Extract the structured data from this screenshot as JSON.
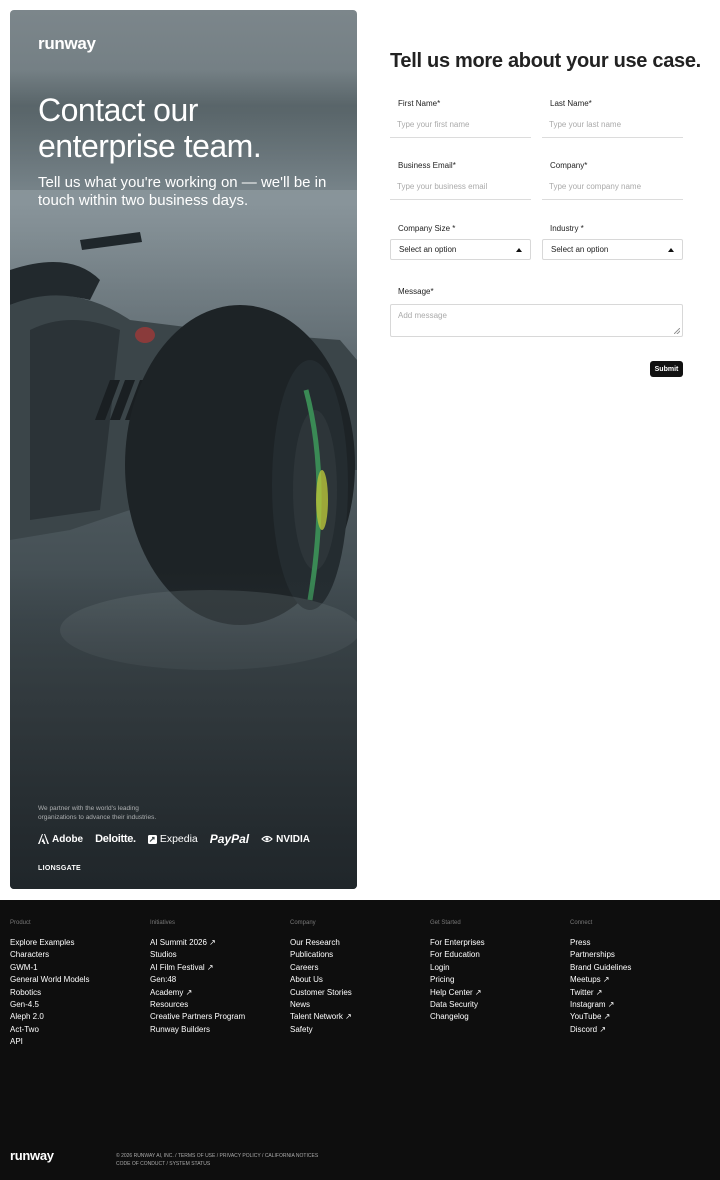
{
  "hero": {
    "logo": "runway",
    "headline": "Contact our enterprise team.",
    "subline": "Tell us what you're working on — we'll be in touch within two business days.",
    "partner_note": "We partner with the world's leading organizations to advance their industries.",
    "partners": [
      "Adobe",
      "Deloitte.",
      "Expedia",
      "PayPal",
      "NVIDIA",
      "LIONSGATE"
    ]
  },
  "form": {
    "title": "Tell us more about your use case.",
    "first_name": {
      "label": "First Name*",
      "placeholder": "Type your first name"
    },
    "last_name": {
      "label": "Last Name*",
      "placeholder": "Type your last name"
    },
    "email": {
      "label": "Business Email*",
      "placeholder": "Type your business email"
    },
    "company": {
      "label": "Company*",
      "placeholder": "Type your company name"
    },
    "company_size": {
      "label": "Company Size *",
      "value": "Select an option"
    },
    "industry": {
      "label": "Industry *",
      "value": "Select an option"
    },
    "message": {
      "label": "Message*",
      "placeholder": "Add message"
    },
    "submit": "Submit"
  },
  "footer": {
    "columns": [
      {
        "head": "Product",
        "links": [
          "Explore Examples",
          "Characters",
          "GWM-1",
          "General World Models",
          "Robotics",
          "Gen-4.5",
          "Aleph 2.0",
          "Act-Two",
          "API"
        ]
      },
      {
        "head": "Initiatives",
        "links": [
          "AI Summit 2026 ↗",
          "Studios",
          "AI Film Festival ↗",
          "Gen:48",
          "Academy ↗",
          "Resources",
          "Creative Partners Program",
          "Runway Builders"
        ]
      },
      {
        "head": "Company",
        "links": [
          "Our Research",
          "Publications",
          "Careers",
          "About Us",
          "Customer Stories",
          "News",
          "Talent Network ↗",
          "Safety"
        ]
      },
      {
        "head": "Get Started",
        "links": [
          "For Enterprises",
          "For Education",
          "Login",
          "Pricing",
          "Help Center ↗",
          "Data Security",
          "Changelog"
        ]
      },
      {
        "head": "Connect",
        "links": [
          "Press",
          "Partnerships",
          "Brand Guidelines",
          "Meetups ↗",
          "Twitter ↗",
          "Instagram ↗",
          "YouTube ↗",
          "Discord ↗"
        ]
      }
    ],
    "logo": "runway",
    "legal_1": "© 2026 RUNWAY AI, INC. / TERMS OF USE / PRIVACY POLICY / CALIFORNIA NOTICES",
    "legal_2": "CODE OF CONDUCT / SYSTEM STATUS"
  }
}
